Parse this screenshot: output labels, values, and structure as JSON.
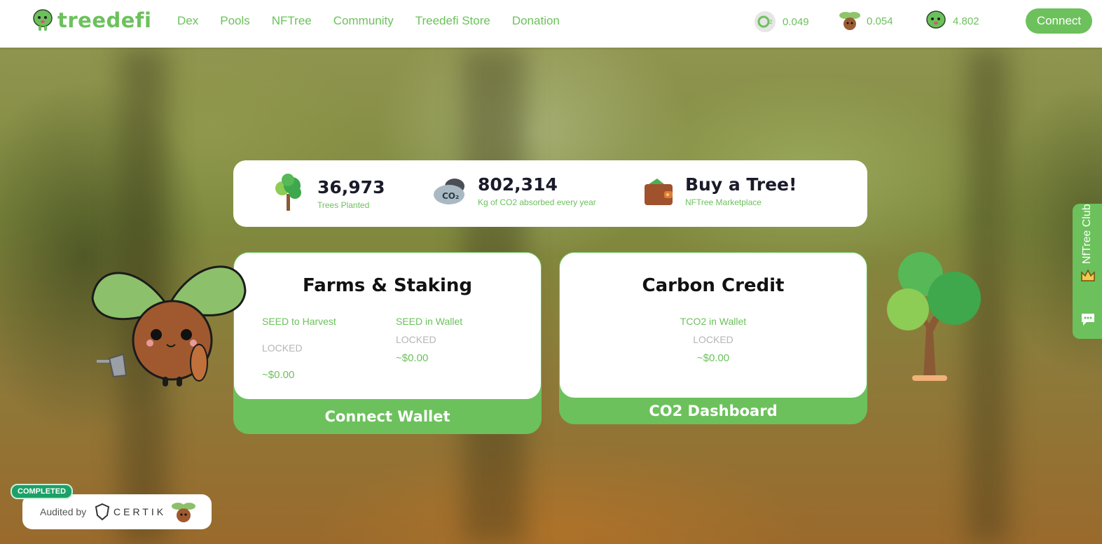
{
  "header": {
    "logo_text": "treedefi",
    "nav": [
      "Dex",
      "Pools",
      "NFTree",
      "Community",
      "Treedefi Store",
      "Donation"
    ],
    "prices": [
      {
        "icon": "co2-token-icon",
        "value": "0.049"
      },
      {
        "icon": "seed-token-icon",
        "value": "0.054"
      },
      {
        "icon": "tree-token-icon",
        "value": "4.802"
      }
    ],
    "connect_label": "Connect"
  },
  "stats": [
    {
      "icon": "tree-icon",
      "value": "36,973",
      "label": "Trees Planted"
    },
    {
      "icon": "co2-cloud-icon",
      "value": "802,314",
      "label": "Kg of CO2 absorbed every year"
    },
    {
      "icon": "wallet-icon",
      "value": "Buy a Tree!",
      "label": "NFTree Marketplace"
    }
  ],
  "farms": {
    "title": "Farms & Staking",
    "harvest_label": "SEED to Harvest",
    "harvest_status": "LOCKED",
    "harvest_value": "~$0.00",
    "wallet_label": "SEED in Wallet",
    "wallet_status": "LOCKED",
    "wallet_value": "~$0.00",
    "button": "Connect Wallet"
  },
  "carbon": {
    "title": "Carbon Credit",
    "wallet_label": "TCO2 in Wallet",
    "wallet_status": "LOCKED",
    "wallet_value": "~$0.00",
    "button": "CO2 Dashboard"
  },
  "side_tab": {
    "label": "NfTree Club"
  },
  "audit": {
    "badge": "COMPLETED",
    "text": "Audited by",
    "brand": "CERTIK"
  },
  "colors": {
    "accent": "#6cc15c",
    "dark_text": "#1a1a2a",
    "badge": "#1da068"
  }
}
